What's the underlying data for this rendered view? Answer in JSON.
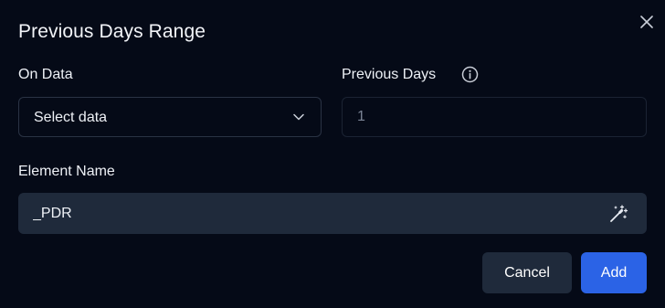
{
  "dialog": {
    "title": "Previous Days Range"
  },
  "on_data": {
    "label": "On Data",
    "selected": "Select data"
  },
  "previous_days": {
    "label": "Previous Days",
    "value": "1"
  },
  "element_name": {
    "label": "Element Name",
    "value": "_PDR"
  },
  "actions": {
    "cancel_label": "Cancel",
    "add_label": "Add"
  },
  "icons": {
    "close": "close-icon",
    "info": "info-icon",
    "chevron": "chevron-down-icon",
    "wand": "magic-wand-icon"
  },
  "colors": {
    "background": "#050a17",
    "field_fill": "#1f2a3b",
    "primary": "#2b63e6"
  }
}
